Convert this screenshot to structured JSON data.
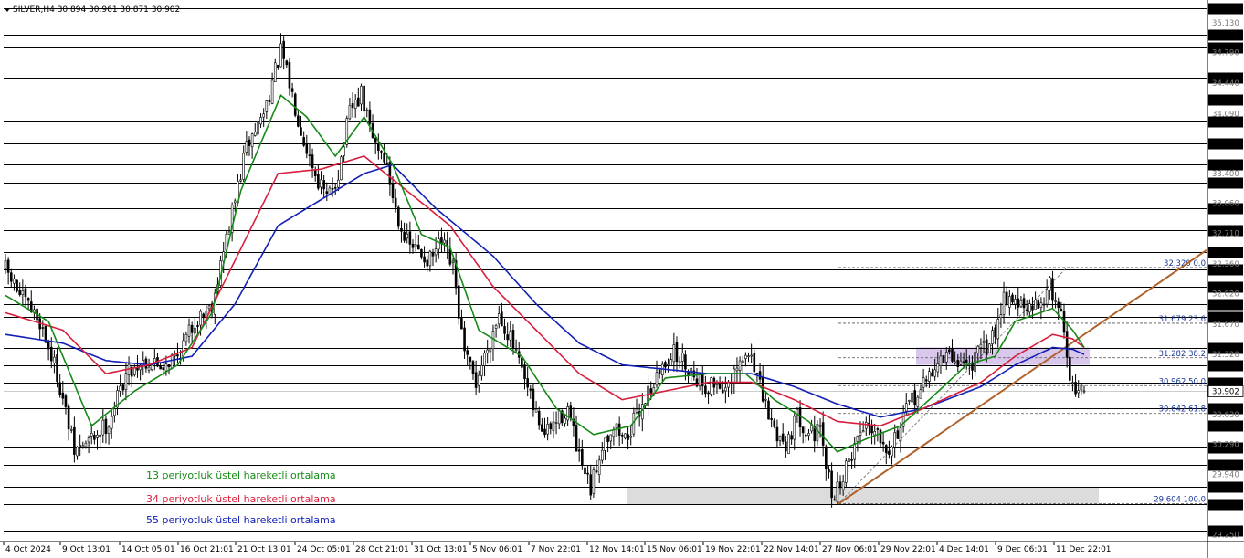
{
  "header": {
    "symbol_text": "SILVER,H4  30.894 30.961 30.871 30.902"
  },
  "colors": {
    "background": "#ffffff",
    "grid_line": "#000000",
    "candle": "#000000",
    "ema13": "#168a16",
    "ema34": "#d81e3c",
    "ema55": "#1220b8",
    "trendline": "#b0622a",
    "fib_dash": "#555555",
    "zone_purple": "#d9c8ec",
    "zone_gray": "#dcdcdc",
    "fib_text": "#1a3a9a",
    "current_price_bg": "#000000"
  },
  "legend": [
    {
      "text": "13 periyotluk üstel hareketli ortalama",
      "color": "#168a16"
    },
    {
      "text": "34 periyotluk üstel hareketli ortalama",
      "color": "#d81e3c"
    },
    {
      "text": "55 periyotluk üstel hareketli ortalama",
      "color": "#1220b8"
    }
  ],
  "chart_data": {
    "type": "candlestick",
    "symbol": "SILVER",
    "timeframe": "H4",
    "ohlc_last": {
      "open": 30.894,
      "high": 30.961,
      "low": 30.871,
      "close": 30.902
    },
    "ylim": [
      29.25,
      35.35
    ],
    "price_levels": [
      35.3,
      35.0,
      34.85,
      34.5,
      34.25,
      34.0,
      33.75,
      33.5,
      33.3,
      33.0,
      32.75,
      32.5,
      32.3,
      32.1,
      31.9,
      31.75,
      31.4,
      31.2,
      31.0,
      30.902,
      30.7,
      30.5,
      30.25,
      30.05,
      29.8,
      29.6,
      29.3
    ],
    "soft_ticks": [
      "35.130",
      "34.790",
      "34.440",
      "34.090",
      "33.400",
      "33.060",
      "32.710",
      "32.360",
      "32.020",
      "31.670",
      "31.320",
      "30.630",
      "30.290",
      "29.940",
      "29.250"
    ],
    "x_ticks": [
      "4 Oct 2024",
      "9 Oct 13:01",
      "14 Oct 05:01",
      "16 Oct 21:01",
      "21 Oct 13:01",
      "24 Oct 05:01",
      "28 Oct 21:01",
      "31 Oct 13:01",
      "5 Nov 06:01",
      "7 Nov 22:01",
      "12 Nov 14:01",
      "15 Nov 06:01",
      "19 Nov 22:01",
      "22 Nov 14:01",
      "27 Nov 06:01",
      "29 Nov 22:01",
      "4 Dec 14:01",
      "9 Dec 06:01",
      "11 Dec 22:01"
    ],
    "fibonacci": [
      {
        "label": "32.320 0.0",
        "price": 32.32
      },
      {
        "label": "31.679 23.6",
        "price": 31.679
      },
      {
        "label": "31.282 38.2",
        "price": 31.282
      },
      {
        "label": "30.962 50.0",
        "price": 30.962
      },
      {
        "label": "30.642 61.8",
        "price": 30.642
      },
      {
        "label": "29.604 100.0",
        "price": 29.604
      }
    ],
    "zones": [
      {
        "name": "resistance",
        "from": 31.2,
        "to": 31.4
      },
      {
        "name": "support",
        "from": 29.6,
        "to": 29.8
      }
    ],
    "price_path": [
      [
        0,
        32.3
      ],
      [
        6,
        31.95
      ],
      [
        12,
        31.7
      ],
      [
        18,
        31.1
      ],
      [
        24,
        30.2
      ],
      [
        30,
        30.35
      ],
      [
        36,
        30.55
      ],
      [
        42,
        31.1
      ],
      [
        48,
        31.25
      ],
      [
        54,
        31.2
      ],
      [
        60,
        31.3
      ],
      [
        66,
        31.7
      ],
      [
        72,
        31.9
      ],
      [
        78,
        32.8
      ],
      [
        84,
        33.7
      ],
      [
        90,
        34.1
      ],
      [
        96,
        34.8
      ],
      [
        100,
        34.3
      ],
      [
        104,
        33.8
      ],
      [
        108,
        33.4
      ],
      [
        112,
        33.1
      ],
      [
        116,
        33.4
      ],
      [
        120,
        34.1
      ],
      [
        124,
        34.3
      ],
      [
        128,
        33.8
      ],
      [
        132,
        33.6
      ],
      [
        136,
        33.0
      ],
      [
        140,
        32.6
      ],
      [
        144,
        32.5
      ],
      [
        148,
        32.4
      ],
      [
        152,
        32.6
      ],
      [
        156,
        32.3
      ],
      [
        160,
        31.3
      ],
      [
        164,
        31.0
      ],
      [
        168,
        31.4
      ],
      [
        172,
        31.8
      ],
      [
        176,
        31.5
      ],
      [
        180,
        31.1
      ],
      [
        184,
        30.7
      ],
      [
        188,
        30.4
      ],
      [
        192,
        30.55
      ],
      [
        196,
        30.7
      ],
      [
        200,
        30.1
      ],
      [
        204,
        29.75
      ],
      [
        208,
        30.3
      ],
      [
        212,
        30.5
      ],
      [
        216,
        30.35
      ],
      [
        220,
        30.6
      ],
      [
        224,
        30.9
      ],
      [
        228,
        31.1
      ],
      [
        232,
        31.35
      ],
      [
        236,
        31.25
      ],
      [
        240,
        31.1
      ],
      [
        244,
        30.95
      ],
      [
        248,
        31.0
      ],
      [
        252,
        30.9
      ],
      [
        256,
        31.2
      ],
      [
        260,
        31.35
      ],
      [
        264,
        30.8
      ],
      [
        268,
        30.45
      ],
      [
        272,
        30.3
      ],
      [
        276,
        30.6
      ],
      [
        280,
        30.45
      ],
      [
        284,
        30.4
      ],
      [
        288,
        29.7
      ],
      [
        292,
        29.9
      ],
      [
        296,
        30.3
      ],
      [
        300,
        30.55
      ],
      [
        304,
        30.45
      ],
      [
        308,
        30.25
      ],
      [
        312,
        30.5
      ],
      [
        316,
        30.8
      ],
      [
        320,
        30.95
      ],
      [
        324,
        31.2
      ],
      [
        328,
        31.3
      ],
      [
        332,
        31.25
      ],
      [
        336,
        31.2
      ],
      [
        340,
        31.35
      ],
      [
        344,
        31.5
      ],
      [
        348,
        32.0
      ],
      [
        352,
        31.95
      ],
      [
        356,
        31.8
      ],
      [
        360,
        31.9
      ],
      [
        364,
        32.1
      ],
      [
        368,
        31.8
      ],
      [
        372,
        30.9
      ],
      [
        376,
        30.902
      ]
    ],
    "ema13_path": [
      [
        0,
        32.0
      ],
      [
        15,
        31.7
      ],
      [
        30,
        30.5
      ],
      [
        45,
        30.9
      ],
      [
        60,
        31.2
      ],
      [
        72,
        31.8
      ],
      [
        82,
        33.2
      ],
      [
        96,
        34.3
      ],
      [
        105,
        34.05
      ],
      [
        115,
        33.6
      ],
      [
        125,
        34.05
      ],
      [
        135,
        33.5
      ],
      [
        145,
        32.7
      ],
      [
        155,
        32.55
      ],
      [
        165,
        31.6
      ],
      [
        180,
        31.3
      ],
      [
        192,
        30.7
      ],
      [
        205,
        30.4
      ],
      [
        218,
        30.5
      ],
      [
        230,
        31.05
      ],
      [
        245,
        31.1
      ],
      [
        258,
        31.1
      ],
      [
        268,
        30.8
      ],
      [
        280,
        30.55
      ],
      [
        290,
        30.2
      ],
      [
        300,
        30.35
      ],
      [
        312,
        30.5
      ],
      [
        322,
        30.8
      ],
      [
        335,
        31.2
      ],
      [
        345,
        31.3
      ],
      [
        352,
        31.7
      ],
      [
        365,
        31.85
      ],
      [
        372,
        31.6
      ],
      [
        376,
        31.4
      ]
    ],
    "ema34_path": [
      [
        0,
        31.8
      ],
      [
        20,
        31.6
      ],
      [
        35,
        31.1
      ],
      [
        50,
        31.2
      ],
      [
        65,
        31.4
      ],
      [
        80,
        32.4
      ],
      [
        95,
        33.4
      ],
      [
        110,
        33.45
      ],
      [
        125,
        33.6
      ],
      [
        140,
        33.2
      ],
      [
        155,
        32.8
      ],
      [
        170,
        32.1
      ],
      [
        185,
        31.6
      ],
      [
        200,
        31.1
      ],
      [
        215,
        30.8
      ],
      [
        230,
        30.9
      ],
      [
        245,
        31.0
      ],
      [
        260,
        31.0
      ],
      [
        275,
        30.8
      ],
      [
        290,
        30.55
      ],
      [
        305,
        30.5
      ],
      [
        320,
        30.7
      ],
      [
        340,
        31.0
      ],
      [
        352,
        31.3
      ],
      [
        365,
        31.55
      ],
      [
        372,
        31.5
      ],
      [
        376,
        31.4
      ]
    ],
    "ema55_path": [
      [
        0,
        31.55
      ],
      [
        20,
        31.45
      ],
      [
        35,
        31.25
      ],
      [
        50,
        31.2
      ],
      [
        65,
        31.3
      ],
      [
        80,
        31.9
      ],
      [
        95,
        32.8
      ],
      [
        110,
        33.1
      ],
      [
        125,
        33.4
      ],
      [
        135,
        33.5
      ],
      [
        150,
        33.0
      ],
      [
        170,
        32.45
      ],
      [
        185,
        31.9
      ],
      [
        200,
        31.45
      ],
      [
        215,
        31.2
      ],
      [
        230,
        31.15
      ],
      [
        245,
        31.1
      ],
      [
        260,
        31.1
      ],
      [
        275,
        30.95
      ],
      [
        290,
        30.75
      ],
      [
        305,
        30.6
      ],
      [
        320,
        30.7
      ],
      [
        340,
        30.95
      ],
      [
        352,
        31.2
      ],
      [
        365,
        31.4
      ],
      [
        372,
        31.38
      ],
      [
        376,
        31.32
      ]
    ]
  }
}
